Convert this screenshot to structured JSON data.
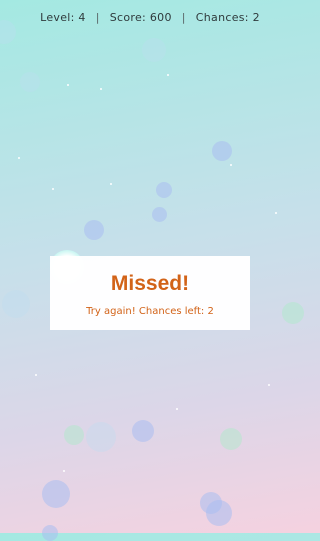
{
  "hud": {
    "level": "Level: 4",
    "score": "Score: 600",
    "chances": "Chances: 2",
    "separator": "|"
  },
  "dialog": {
    "title": "Missed!",
    "message": "Try again! Chances left: 2"
  },
  "colors": {
    "accent": "#d26318",
    "hud_text": "#2f3a3c",
    "background_top": "#a4e9e2",
    "background_bottom": "#f5d2e0"
  }
}
